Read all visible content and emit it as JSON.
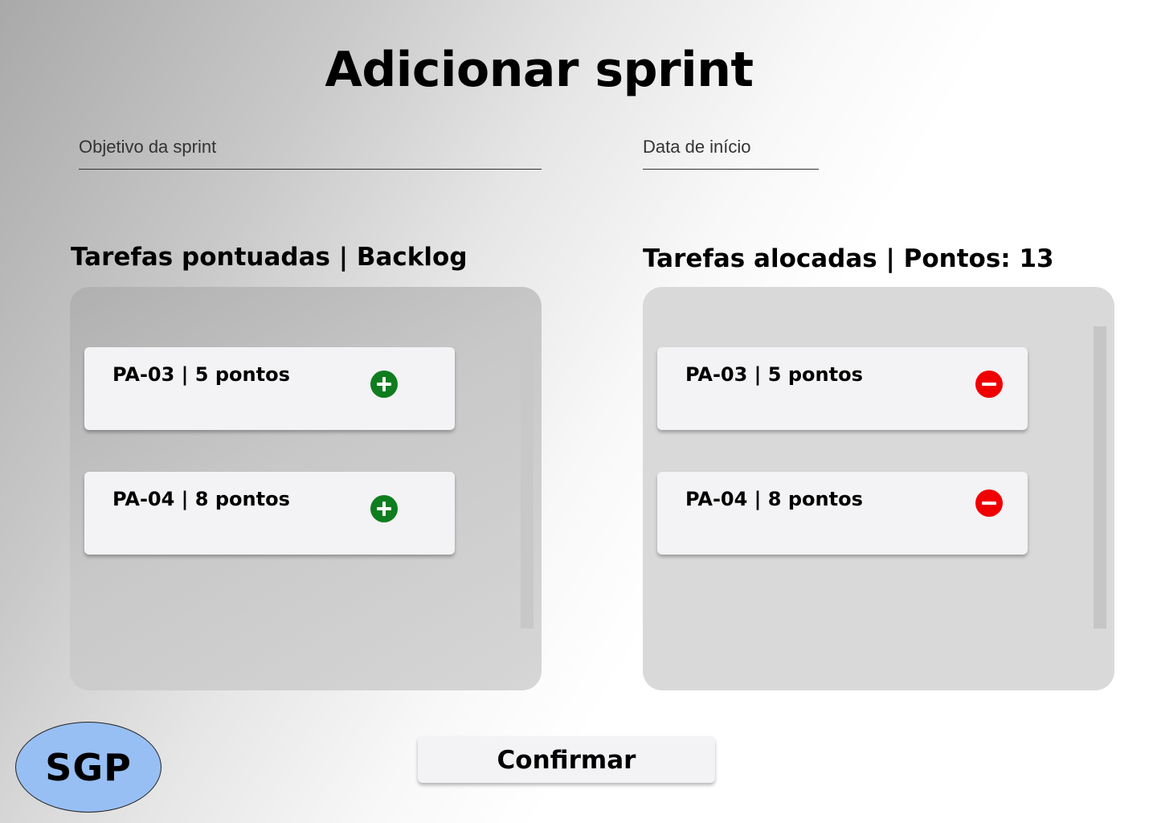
{
  "page": {
    "title": "Adicionar sprint"
  },
  "form": {
    "objective_placeholder": "Objetivo da sprint",
    "objective_value": "",
    "start_date_placeholder": "Data de início",
    "start_date_value": ""
  },
  "backlog": {
    "heading": "Tarefas pontuadas | Backlog",
    "add_icon_color": "#0f7d1f",
    "tasks": [
      {
        "label": "PA-03 | 5 pontos",
        "action_icon": "plus-circle-icon"
      },
      {
        "label": "PA-04 | 8 pontos",
        "action_icon": "plus-circle-icon"
      }
    ]
  },
  "allocated": {
    "heading": "Tarefas alocadas | Pontos: 13",
    "remove_icon_color": "#f00000",
    "tasks": [
      {
        "label": "PA-03 | 5 pontos",
        "action_icon": "minus-circle-icon"
      },
      {
        "label": "PA-04 | 8 pontos",
        "action_icon": "minus-circle-icon"
      }
    ]
  },
  "actions": {
    "confirm_label": "Confirmar"
  },
  "logo": {
    "text": "SGP",
    "color": "#97bff3"
  }
}
